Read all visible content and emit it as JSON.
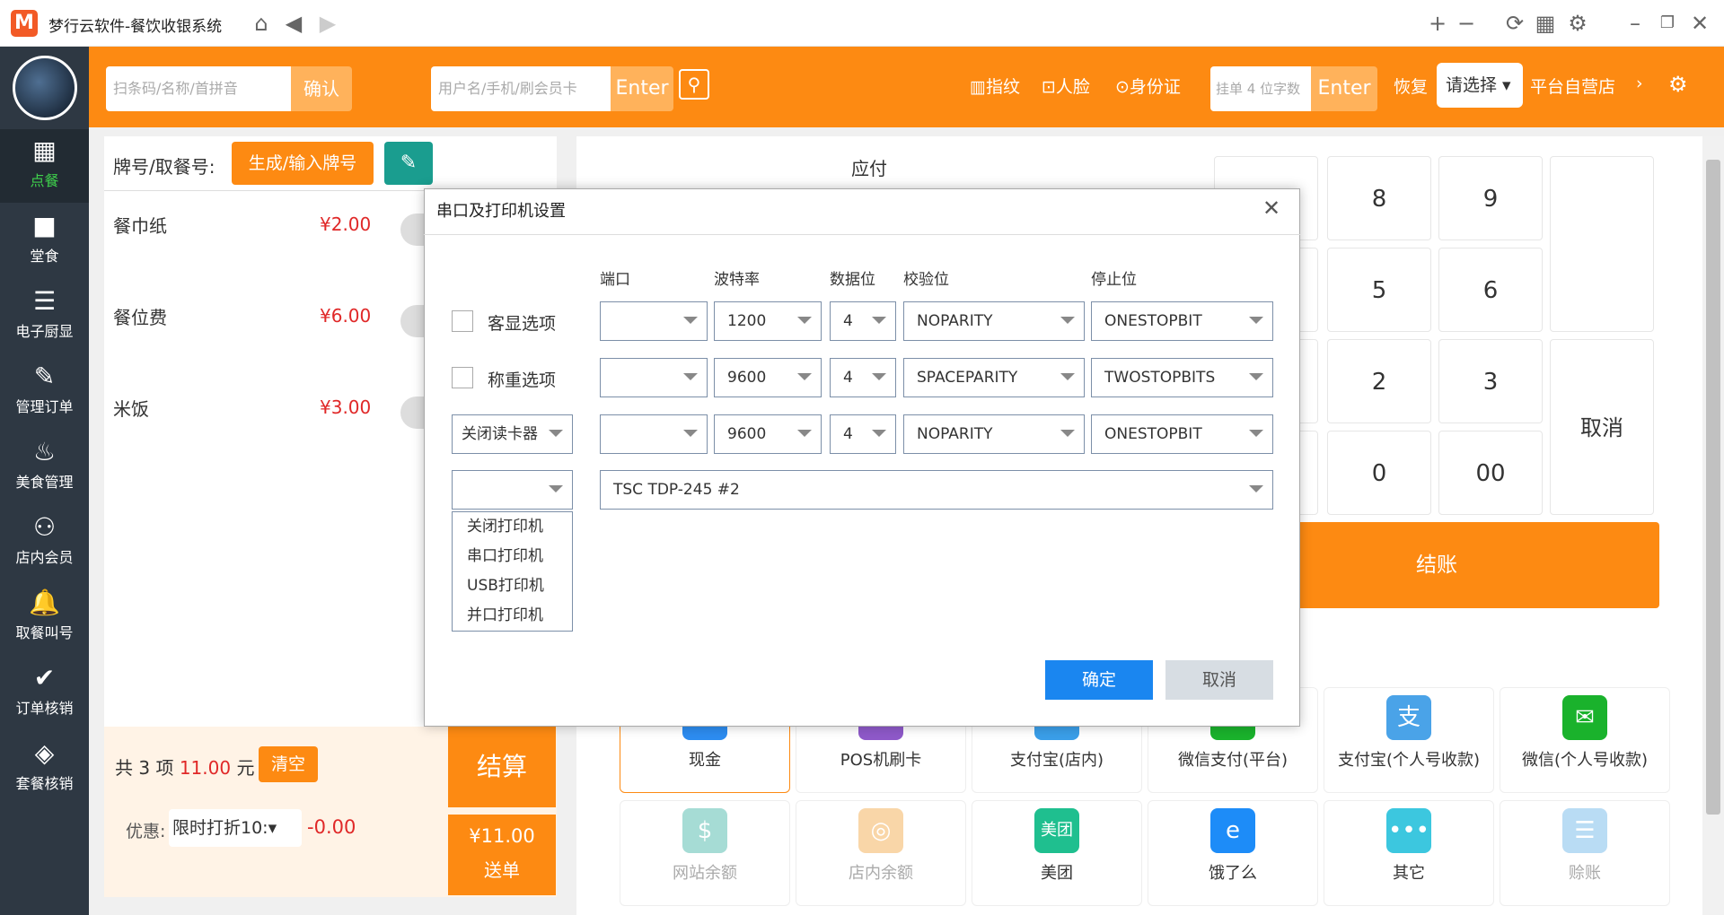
{
  "window": {
    "title": "梦行云软件-餐饮收银系统",
    "logo": "M"
  },
  "sidebar": {
    "items": [
      {
        "label": "点餐",
        "icon": "storefront-icon",
        "glyph": "▦"
      },
      {
        "label": "堂食",
        "icon": "grid-icon",
        "glyph": "■"
      },
      {
        "label": "电子厨显",
        "icon": "list-icon",
        "glyph": "☰"
      },
      {
        "label": "管理订单",
        "icon": "order-icon",
        "glyph": "✎"
      },
      {
        "label": "美食管理",
        "icon": "chef-hat-icon",
        "glyph": "♨"
      },
      {
        "label": "店内会员",
        "icon": "members-icon",
        "glyph": "⚇"
      },
      {
        "label": "取餐叫号",
        "icon": "bell-icon",
        "glyph": "🔔"
      },
      {
        "label": "订单核销",
        "icon": "abc-check-icon",
        "glyph": "✔"
      },
      {
        "label": "套餐核销",
        "icon": "package-icon",
        "glyph": "◈"
      }
    ]
  },
  "topbar": {
    "scan_placeholder": "扫条码/名称/首拼音",
    "confirm_label": "确认",
    "member_placeholder": "用户名/手机/刷会员卡",
    "enter_label": "Enter",
    "fingerprint": "指纹",
    "face": "人脸",
    "idcard": "身份证",
    "hang_placeholder": "挂单 4 位字数",
    "enter2_label": "Enter",
    "restore": "恢复",
    "select_label": "请选择",
    "store": "平台自营店"
  },
  "order": {
    "tag_label": "牌号/取餐号:",
    "gen_button": "生成/输入牌号",
    "items": [
      {
        "name": "餐巾纸",
        "price": "¥2.00"
      },
      {
        "name": "餐位费",
        "price": "¥6.00"
      },
      {
        "name": "米饭",
        "price": "¥3.00"
      }
    ],
    "summary_prefix": "共 3 项",
    "summary_total": "11.00",
    "summary_unit": "元",
    "clear_label": "清空",
    "checkout_label": "结算",
    "discount_label": "优惠:",
    "discount_select": "限时打折10:",
    "discount_value": "-0.00",
    "send_amount": "¥11.00",
    "send_label": "送单"
  },
  "pay": {
    "due_label": "应付",
    "keys": [
      "8",
      "9",
      "5",
      "6",
      "2",
      "3",
      "0",
      "00"
    ],
    "cancel_label": "取消",
    "checkout_label": "结账",
    "methods_row1": [
      {
        "label": "现金",
        "color": "#2d8cf0"
      },
      {
        "label": "POS机刷卡",
        "color": "#8e59c9"
      },
      {
        "label": "支付宝(店内)",
        "color": "#3a9ee8"
      },
      {
        "label": "微信支付(平台)",
        "color": "#1ab22c"
      },
      {
        "label": "支付宝(个人号收款)",
        "color": "#4aa3e8",
        "glyph": "支"
      },
      {
        "label": "微信(个人号收款)",
        "color": "#1ab22c",
        "glyph": "✉"
      }
    ],
    "methods_row2": [
      {
        "label": "网站余额",
        "color": "#a6dcd5",
        "glyph": "$"
      },
      {
        "label": "店内余额",
        "color": "#f9d6a8",
        "glyph": "◎"
      },
      {
        "label": "美团",
        "color": "#1fbf8f",
        "glyph": "美团"
      },
      {
        "label": "饿了么",
        "color": "#1d8cf8",
        "glyph": "e"
      },
      {
        "label": "其它",
        "color": "#3cc7df",
        "glyph": "•••"
      },
      {
        "label": "赊账",
        "color": "#b9dcf4",
        "glyph": "☰"
      }
    ]
  },
  "dialog": {
    "title": "串口及打印机设置",
    "headers": {
      "port": "端口",
      "baud": "波特率",
      "databits": "数据位",
      "parity": "校验位",
      "stopbits": "停止位"
    },
    "rows": [
      {
        "label": "客显选项",
        "port": "",
        "baud": "1200",
        "databits": "4",
        "parity": "NOPARITY",
        "stopbits": "ONESTOPBIT"
      },
      {
        "label": "称重选项",
        "port": "",
        "baud": "9600",
        "databits": "4",
        "parity": "SPACEPARITY",
        "stopbits": "TWOSTOPBITS"
      },
      {
        "label": "关闭读卡器",
        "port": "",
        "baud": "9600",
        "databits": "4",
        "parity": "NOPARITY",
        "stopbits": "ONESTOPBIT"
      }
    ],
    "printer_type": "",
    "printer_name": "TSC TDP-245 #2",
    "printer_options": [
      "关闭打印机",
      "串口打印机",
      "USB打印机",
      "并口打印机"
    ],
    "ok_label": "确定",
    "cancel_label": "取消"
  }
}
